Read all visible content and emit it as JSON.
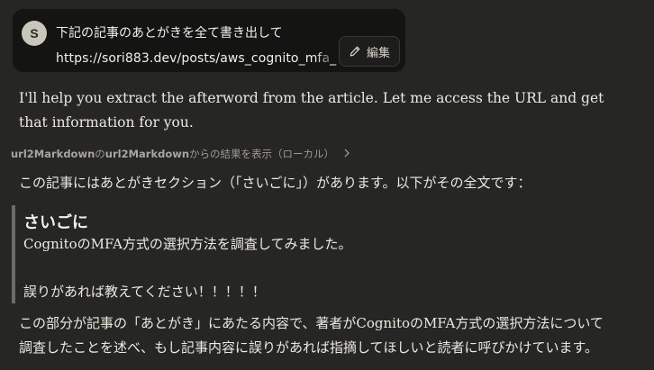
{
  "user_message": {
    "avatar_initial": "S",
    "line1": "下記の記事のあとがきを全て書き出して",
    "line2": "https://sori883.dev/posts/aws_cognito_mfa_",
    "edit_label": "編集"
  },
  "assistant": {
    "intro": "I'll help you extract the afterword from the article. Let me access the URL and get that information for you.",
    "tool_call": {
      "server": "url2Markdown",
      "connector": "の",
      "tool": "url2Markdown",
      "suffix": "からの結果を表示（ローカル）"
    },
    "lead": "この記事にはあとがきセクション（「さいごに」）があります。以下がその全文です：",
    "quote": {
      "heading": "さいごに",
      "line1": "CognitoのMFA方式の選択方法を調査してみました。",
      "line2": "誤りがあれば教えてください！！！！！"
    },
    "summary_line1": "この部分が記事の「あとがき」にあたる内容で、著者がCognitoのMFA方式の選択方法について",
    "summary_line2": "調査したことを述べ、もし記事内容に誤りがあれば指摘してほしいと読者に呼びかけています。"
  },
  "icons": {
    "edit": "pencil-icon",
    "expand": "chevron-right-icon"
  },
  "colors": {
    "background": "#262624",
    "bubble": "#141413",
    "text": "#ece9e1",
    "muted": "#9d9a91",
    "quote_bar": "#6f6c66"
  }
}
